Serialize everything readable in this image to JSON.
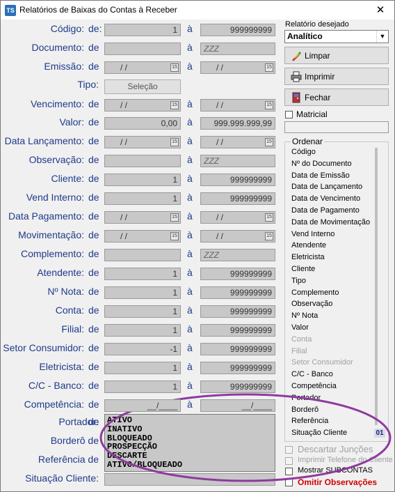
{
  "window": {
    "title": "Relatórios de Baixas do Contas à Receber",
    "app_icon": "TS",
    "close_glyph": "✕"
  },
  "form": {
    "de": "de",
    "de_colon": "de:",
    "a": "à",
    "tipo_label": "Tipo:",
    "tipo_button": "Seleção",
    "rows": [
      {
        "label": "Código:",
        "from": "1",
        "to": "999999999"
      },
      {
        "label": "Documento:",
        "from": "",
        "to": "ZZZ"
      },
      {
        "label": "Emissão:",
        "from": "/ /",
        "to": "/ /"
      },
      {
        "label": "Vencimento:",
        "from": "/ /",
        "to": "/ /"
      },
      {
        "label": "Valor:",
        "from": "0,00",
        "to": "999.999.999,99"
      },
      {
        "label": "Data Lançamento:",
        "from": "/ /",
        "to": "/ /"
      },
      {
        "label": "Observação:",
        "from": "",
        "to": "ZZZ"
      },
      {
        "label": "Cliente:",
        "from": "1",
        "to": "999999999"
      },
      {
        "label": "Vend Interno:",
        "from": "1",
        "to": "999999999"
      },
      {
        "label": "Data Pagamento:",
        "from": "/ /",
        "to": "/ /"
      },
      {
        "label": "Movimentação:",
        "from": "/ /",
        "to": "/ /"
      },
      {
        "label": "Complemento:",
        "from": "",
        "to": "ZZZ"
      },
      {
        "label": "Atendente:",
        "from": "1",
        "to": "999999999"
      },
      {
        "label": "Nº Nota:",
        "from": "1",
        "to": "999999999"
      },
      {
        "label": "Conta:",
        "from": "1",
        "to": "999999999"
      },
      {
        "label": "Filial:",
        "from": "1",
        "to": "999999999"
      },
      {
        "label": "Setor Consumidor:",
        "from": "-1",
        "to": "999999999"
      },
      {
        "label": "Eletricista:",
        "from": "1",
        "to": "999999999"
      },
      {
        "label": "C/C - Banco:",
        "from": "1",
        "to": "999999999"
      },
      {
        "label": "Competência:",
        "from": "__/____",
        "to": "__/____"
      }
    ],
    "partial_labels": {
      "portador": "Portador:",
      "bordero": "Borderô",
      "referencia": "Referência",
      "situacao": "Situação Cliente:"
    },
    "portador_de": "de",
    "bordero_de": "de",
    "referencia_de": "de",
    "situacao_options": [
      "ATIVO",
      "INATIVO",
      "BLOQUEADO",
      "PROSPECÇÃO",
      "DESCARTE",
      "ATIVO/BLOQUEADO"
    ],
    "calendar_icon_text": "15"
  },
  "right": {
    "relatorio_label": "Relatório desejado",
    "relatorio_value": "Analítico",
    "limpar": "Limpar",
    "imprimir": "Imprimir",
    "fechar": "Fechar",
    "matricial": "Matricial",
    "ordenar_title": "Ordenar",
    "ordenar_items": [
      {
        "label": "Código",
        "enabled": true
      },
      {
        "label": "Nº do Documento",
        "enabled": true
      },
      {
        "label": "Data de Emissão",
        "enabled": true
      },
      {
        "label": "Data de Lançamento",
        "enabled": true
      },
      {
        "label": "Data de Vencimento",
        "enabled": true
      },
      {
        "label": "Data de Pagamento",
        "enabled": true
      },
      {
        "label": "Data de Movimentação",
        "enabled": true
      },
      {
        "label": "Vend Interno",
        "enabled": true
      },
      {
        "label": "Atendente",
        "enabled": true
      },
      {
        "label": "Eletricista",
        "enabled": true
      },
      {
        "label": "Cliente",
        "enabled": true
      },
      {
        "label": "Tipo",
        "enabled": true
      },
      {
        "label": "Complemento",
        "enabled": true
      },
      {
        "label": "Observação",
        "enabled": true
      },
      {
        "label": "Nº Nota",
        "enabled": true
      },
      {
        "label": "Valor",
        "enabled": true
      },
      {
        "label": "Conta",
        "enabled": false
      },
      {
        "label": "Filial",
        "enabled": false
      },
      {
        "label": "Setor Consumidor",
        "enabled": false
      },
      {
        "label": "C/C - Banco",
        "enabled": true
      },
      {
        "label": "Competência",
        "enabled": true
      },
      {
        "label": "Portador",
        "enabled": true
      },
      {
        "label": "Borderô",
        "enabled": true
      },
      {
        "label": "Referência",
        "enabled": true
      },
      {
        "label": "Situação Cliente",
        "enabled": true
      }
    ],
    "ordenar_badge": "01",
    "descartar_juncoes": "Descartar Junções",
    "imprimir_telefone": "Imprimir Telefone do Cliente",
    "mostrar_subcontas": "Mostrar SUBCONTAS",
    "omitir_observacoes": "Omitir Observações"
  },
  "colors": {
    "label_blue": "#1f3a8a",
    "annotation_purple": "#8e3a9d",
    "omitir_red": "#d00000"
  }
}
